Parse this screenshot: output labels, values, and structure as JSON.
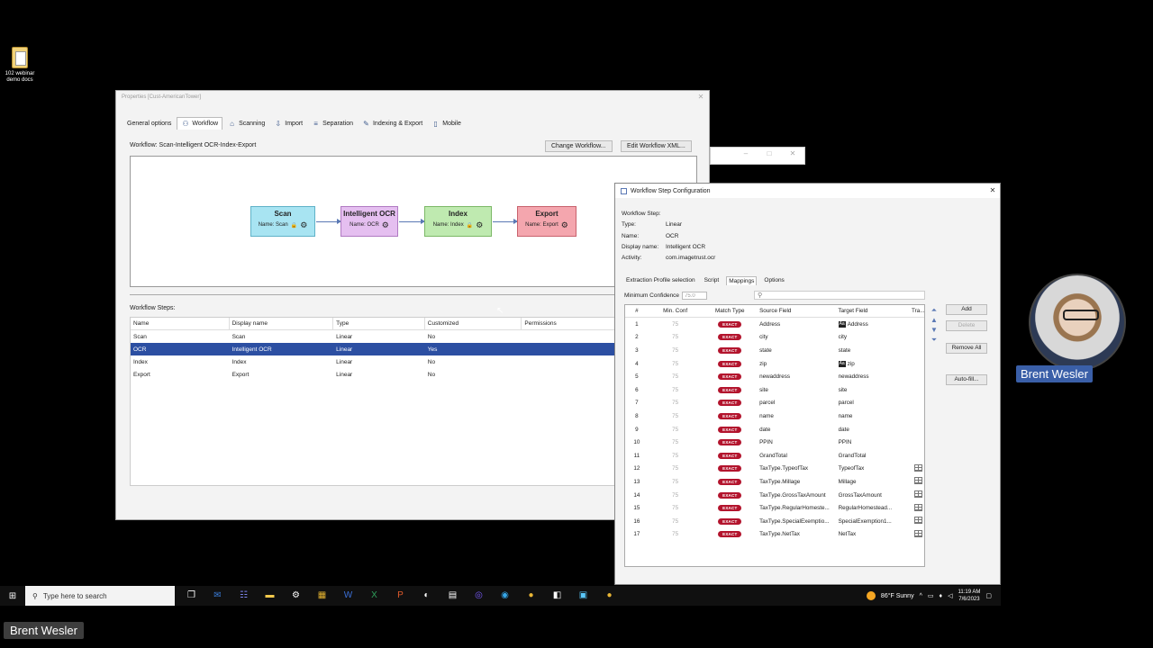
{
  "desktop": {
    "icon_label": "102 webinar demo docs"
  },
  "props_window": {
    "title": "Properties [Cust-AmericanTower]",
    "tabs": [
      "General options",
      "Workflow",
      "Scanning",
      "Import",
      "Separation",
      "Indexing & Export",
      "Mobile"
    ],
    "workflow_label": "Workflow:  Scan-Intelligent OCR-Index-Export",
    "change_btn": "Change Workflow...",
    "edit_btn": "Edit Workflow XML...",
    "nodes": [
      {
        "title": "Scan",
        "name": "Name: Scan",
        "color": "#a8e4f2",
        "border": "#5fb2c8"
      },
      {
        "title": "Intelligent OCR",
        "name": "Name: OCR",
        "color": "#e5bff0",
        "border": "#b07ac2"
      },
      {
        "title": "Index",
        "name": "Name: Index",
        "color": "#bfeab0",
        "border": "#7cb867"
      },
      {
        "title": "Export",
        "name": "Name: Export",
        "color": "#f4a6ae",
        "border": "#c8626d"
      }
    ],
    "steps_label": "Workflow Steps:",
    "steps_headers": [
      "Name",
      "Display name",
      "Type",
      "Customized",
      "Permissions"
    ],
    "steps_rows": [
      [
        "Scan",
        "Scan",
        "Linear",
        "No",
        ""
      ],
      [
        "OCR",
        "Intelligent OCR",
        "Linear",
        "Yes",
        ""
      ],
      [
        "Index",
        "Index",
        "Linear",
        "No",
        ""
      ],
      [
        "Export",
        "Export",
        "Linear",
        "No",
        ""
      ]
    ]
  },
  "config_window": {
    "title": "Workflow Step Configuration",
    "section": "Workflow Step:",
    "info": [
      [
        "Type:",
        "Linear"
      ],
      [
        "Name:",
        "OCR"
      ],
      [
        "Display name:",
        "Intelligent OCR"
      ],
      [
        "Activity:",
        "com.imagetrust.ocr"
      ]
    ],
    "tabs": [
      "Extraction Profile selection",
      "Script",
      "Mappings",
      "Options"
    ],
    "min_conf_label": "Minimum Confidence",
    "min_conf_value": "75.0",
    "search_glyph": "⚲",
    "table_headers": [
      "#",
      "Min. Conf",
      "Match Type",
      "Source Field",
      "Target Field",
      "Tra..."
    ],
    "match_type": "EXACT",
    "aa_label": "Aa",
    "rows": [
      {
        "n": "1",
        "conf": "75",
        "src": "Address",
        "tgt": "Address",
        "aa": true,
        "grid": false
      },
      {
        "n": "2",
        "conf": "75",
        "src": "city",
        "tgt": "city",
        "aa": false,
        "grid": false
      },
      {
        "n": "3",
        "conf": "75",
        "src": "state",
        "tgt": "state",
        "aa": false,
        "grid": false
      },
      {
        "n": "4",
        "conf": "75",
        "src": "zip",
        "tgt": "zip",
        "aa": true,
        "grid": false
      },
      {
        "n": "5",
        "conf": "75",
        "src": "newaddress",
        "tgt": "newaddress",
        "aa": false,
        "grid": false
      },
      {
        "n": "6",
        "conf": "75",
        "src": "site",
        "tgt": "site",
        "aa": false,
        "grid": false
      },
      {
        "n": "7",
        "conf": "75",
        "src": "parcel",
        "tgt": "parcel",
        "aa": false,
        "grid": false
      },
      {
        "n": "8",
        "conf": "75",
        "src": "name",
        "tgt": "name",
        "aa": false,
        "grid": false
      },
      {
        "n": "9",
        "conf": "75",
        "src": "date",
        "tgt": "date",
        "aa": false,
        "grid": false
      },
      {
        "n": "10",
        "conf": "75",
        "src": "PPIN",
        "tgt": "PPIN",
        "aa": false,
        "grid": false
      },
      {
        "n": "11",
        "conf": "75",
        "src": "GrandTotal",
        "tgt": "GrandTotal",
        "aa": false,
        "grid": false
      },
      {
        "n": "12",
        "conf": "75",
        "src": "TaxType.TypeofTax",
        "tgt": "TypeofTax",
        "aa": false,
        "grid": true
      },
      {
        "n": "13",
        "conf": "75",
        "src": "TaxType.Millage",
        "tgt": "Millage",
        "aa": false,
        "grid": true
      },
      {
        "n": "14",
        "conf": "75",
        "src": "TaxType.GrossTaxAmount",
        "tgt": "GrossTaxAmount",
        "aa": false,
        "grid": true
      },
      {
        "n": "15",
        "conf": "75",
        "src": "TaxType.RegularHomeste...",
        "tgt": "RegularHomestead...",
        "aa": false,
        "grid": true
      },
      {
        "n": "16",
        "conf": "75",
        "src": "TaxType.SpecialExemptio...",
        "tgt": "SpecialExemption1...",
        "aa": false,
        "grid": true
      },
      {
        "n": "17",
        "conf": "75",
        "src": "TaxType.NetTax",
        "tgt": "NetTax",
        "aa": false,
        "grid": true
      }
    ],
    "btn_add": "Add",
    "btn_delete": "Delete",
    "btn_remove_all": "Remove All",
    "btn_autofill": "Auto-fill..."
  },
  "webcam": {
    "name": "Brent Wesler"
  },
  "taskbar": {
    "search_placeholder": "Type here to search",
    "weather": "86°F  Sunny",
    "time": "11:19 AM",
    "date": "7/6/2023"
  },
  "bottom_name": "Brent Wesler"
}
